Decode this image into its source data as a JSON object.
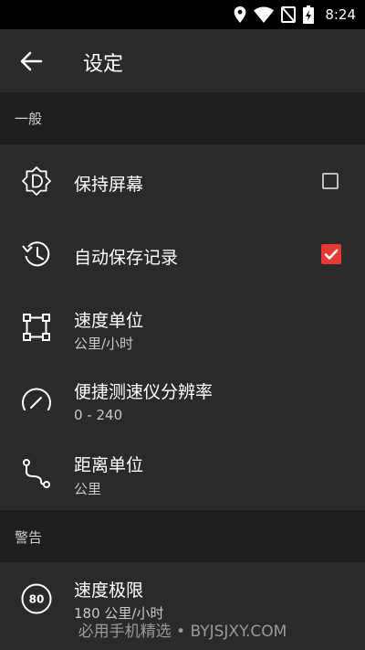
{
  "status_bar": {
    "time": "8:24",
    "icons": [
      "location-icon",
      "wifi-icon",
      "no-sim-icon",
      "battery-charging-icon"
    ]
  },
  "app_bar": {
    "title": "设定",
    "back_icon": "arrow-left-icon"
  },
  "sections": {
    "general": {
      "label": "一般"
    },
    "warning": {
      "label": "警告"
    }
  },
  "items": {
    "keep_screen": {
      "title": "保持屏幕",
      "icon": "screen-d-icon",
      "checked": false
    },
    "auto_save": {
      "title": "自动保存记录",
      "icon": "history-icon",
      "checked": true
    },
    "speed_unit": {
      "title": "速度单位",
      "value": "公里/小时",
      "icon": "vector-square-icon"
    },
    "speedometer_res": {
      "title": "便捷测速仪分辨率",
      "value": "0 - 240",
      "icon": "speedometer-icon"
    },
    "distance_unit": {
      "title": "距离单位",
      "value": "公里",
      "icon": "route-icon"
    },
    "speed_limit": {
      "title": "速度极限",
      "value": "180 公里/小时",
      "icon": "speed-limit-80-icon",
      "icon_text": "80"
    }
  },
  "colors": {
    "accent": "#e53935",
    "background": "#2a2a2a",
    "section_bg": "#1e1e1e"
  },
  "watermark": "必用手机精选 • BYJSJXY.COM"
}
